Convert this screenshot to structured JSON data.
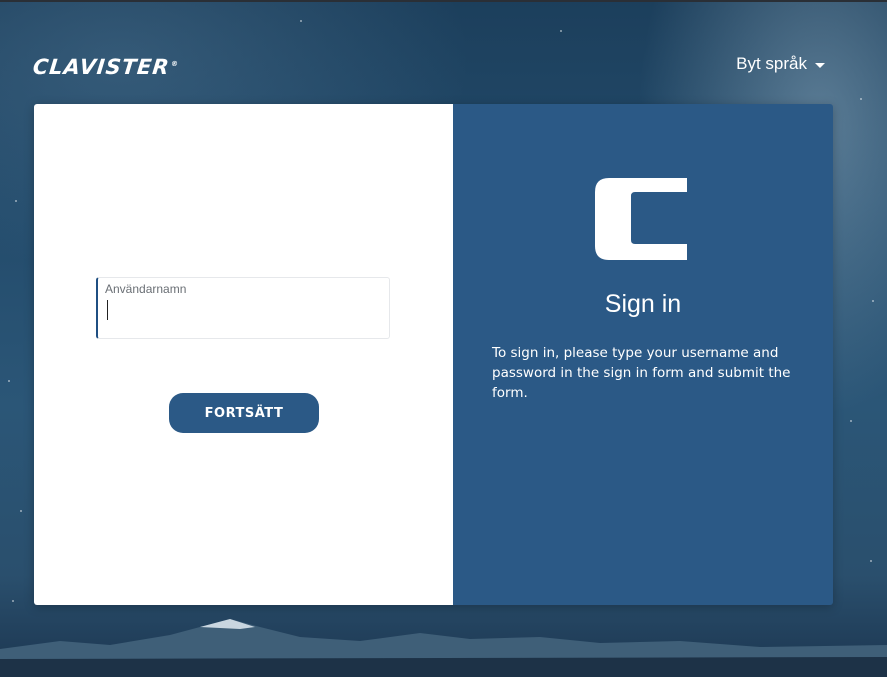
{
  "brand": {
    "logo_text": "CLAVISTER"
  },
  "header": {
    "language_label": "Byt språk"
  },
  "login_form": {
    "username_label": "Användarnamn",
    "username_value": "",
    "submit_label": "FORTSÄTT"
  },
  "info_panel": {
    "title": "Sign in",
    "description": "To sign in, please type your username and password in the sign in form and submit the form."
  },
  "colors": {
    "panel_blue": "#2b5986",
    "button_blue": "#2b5986",
    "field_accent": "#1f4f82"
  },
  "icons": {
    "language_dropdown": "chevron-down-icon",
    "brand_mark": "clavister-c-logo"
  }
}
